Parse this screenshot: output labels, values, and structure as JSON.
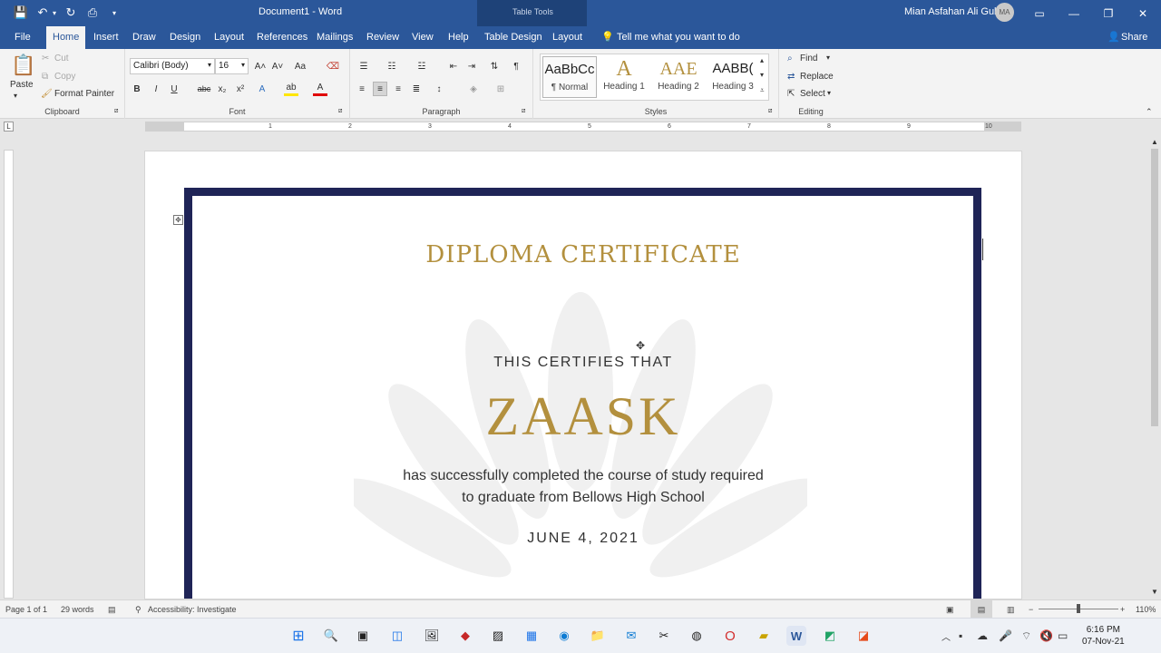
{
  "window": {
    "title": "Document1  -  Word",
    "context_label": "Table Tools",
    "user_name": "Mian Asfahan Ali Gul",
    "user_initials": "MA"
  },
  "tabs": [
    "File",
    "Home",
    "Insert",
    "Draw",
    "Design",
    "Layout",
    "References",
    "Mailings",
    "Review",
    "View",
    "Help",
    "Table Design",
    "Layout"
  ],
  "tell_me": "Tell me what you want to do",
  "share": "Share",
  "ribbon": {
    "clipboard": {
      "paste": "Paste",
      "cut": "Cut",
      "copy": "Copy",
      "format_painter": "Format Painter",
      "label": "Clipboard"
    },
    "font": {
      "name": "Calibri (Body)",
      "size": "16",
      "label": "Font"
    },
    "paragraph": {
      "label": "Paragraph"
    },
    "styles": {
      "items": [
        {
          "preview": "AaBbCc",
          "name": "¶ Normal"
        },
        {
          "preview": "A",
          "name": "Heading 1"
        },
        {
          "preview": "AAE",
          "name": "Heading 2"
        },
        {
          "preview": "AABB(",
          "name": "Heading 3"
        }
      ],
      "label": "Styles"
    },
    "editing": {
      "find": "Find",
      "replace": "Replace",
      "select": "Select",
      "label": "Editing"
    }
  },
  "ruler_numbers": [
    "1",
    "2",
    "3",
    "4",
    "5",
    "6",
    "7",
    "8",
    "9",
    "10"
  ],
  "document": {
    "title": "DIPLOMA CERTIFICATE",
    "certifies": "THIS CERTIFIES THAT",
    "name": "ZAASK",
    "desc_line1": "has successfully completed the course of study required",
    "desc_line2": "to graduate from Bellows High School",
    "date": "JUNE 4, 2021"
  },
  "status": {
    "page": "Page 1 of 1",
    "words": "29 words",
    "accessibility": "Accessibility: Investigate",
    "zoom": "110%"
  },
  "clock": {
    "time": "6:16 PM",
    "date": "07-Nov-21"
  },
  "colors": {
    "brand": "#2b579a",
    "gold": "#b3903e",
    "frame": "#1f2457"
  }
}
